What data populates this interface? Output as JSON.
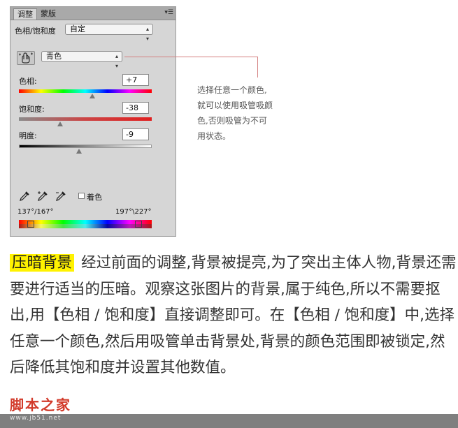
{
  "panel": {
    "tabs": [
      {
        "label": "调整"
      },
      {
        "label": "蒙版"
      }
    ],
    "preset_label": "色相/饱和度",
    "preset_value": "自定",
    "channel_value": "青色",
    "hue": {
      "label": "色相:",
      "value": "+7",
      "thumb_pct": 0.55
    },
    "saturation": {
      "label": "饱和度:",
      "value": "-38",
      "thumb_pct": 0.31
    },
    "lightness": {
      "label": "明度:",
      "value": "-9",
      "thumb_pct": 0.45
    },
    "colorize_label": "着色",
    "range_left": "137°/167°",
    "range_right": "197°\\227°"
  },
  "annotation": {
    "lines": [
      "选择任意一个颜色,",
      "就可以使用吸管吸颜",
      "色,否则吸管为不可",
      "用状态。"
    ]
  },
  "article": {
    "heading": "压暗背景",
    "body": "经过前面的调整,背景被提亮,为了突出主体人物,背景还需要进行适当的压暗。观察这张图片的背景,属于纯色,所以不需要抠出,用【色相 / 饱和度】直接调整即可。在【色相 / 饱和度】中,选择任意一个颜色,然后用吸管单击背景处,背景的颜色范围即被锁定,然后降低其饱和度并设置其他数值。"
  },
  "watermark": {
    "title": "脚本之家",
    "url": "www.jb51.net"
  },
  "icons": [
    "hand-target-icon",
    "eyedropper-icon",
    "eyedropper-plus-icon",
    "eyedropper-minus-icon",
    "panel-menu-icon",
    "dropdown-arrow-icon"
  ]
}
